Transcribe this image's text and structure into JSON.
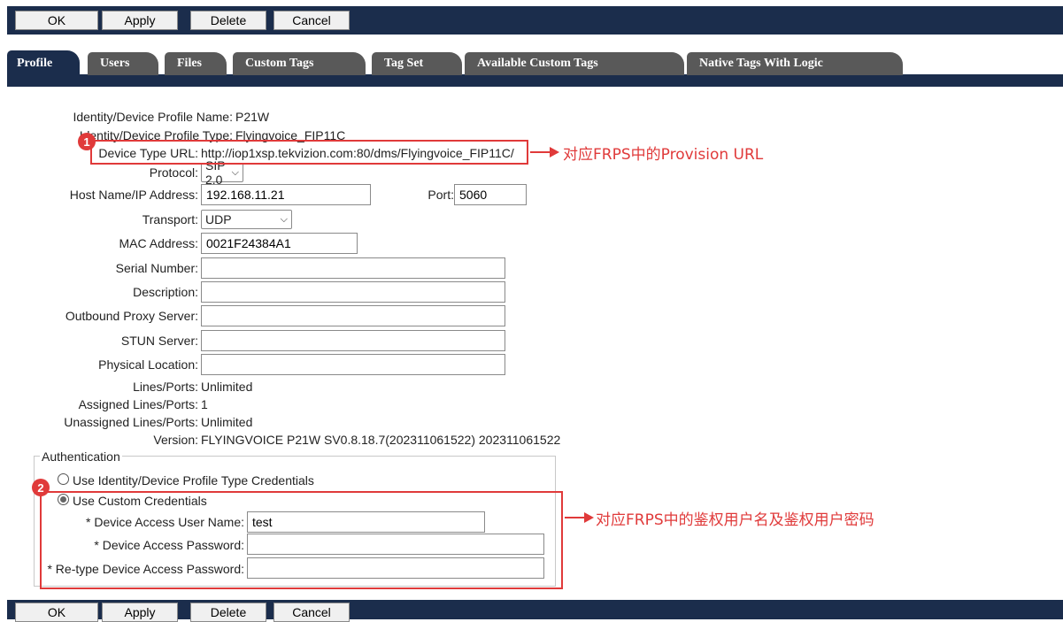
{
  "toolbar": {
    "ok": "OK",
    "apply": "Apply",
    "delete": "Delete",
    "cancel": "Cancel"
  },
  "tabs": [
    "Profile",
    "Users",
    "Files",
    "Custom Tags",
    "Tag Set",
    "Available Custom Tags",
    "Native Tags With Logic"
  ],
  "active_tab": "Profile",
  "profile": {
    "profile_name_label": "Identity/Device Profile Name:",
    "profile_name": "P21W",
    "profile_type_label": "Identity/Device Profile Type:",
    "profile_type": "Flyingvoice_FIP11C",
    "device_type_url_label": "Device Type URL:",
    "device_type_url": "http://iop1xsp.tekvizion.com:80/dms/Flyingvoice_FIP11C/",
    "protocol_label": "Protocol:",
    "protocol": "SIP 2.0",
    "host_label": "Host Name/IP Address:",
    "host": "192.168.11.21",
    "port_label": "Port:",
    "port": "5060",
    "transport_label": "Transport:",
    "transport": "UDP",
    "mac_label": "MAC Address:",
    "mac": "0021F24384A1",
    "serial_label": "Serial Number:",
    "serial": "",
    "description_label": "Description:",
    "description": "",
    "outbound_proxy_label": "Outbound Proxy Server:",
    "outbound_proxy": "",
    "stun_label": "STUN Server:",
    "stun": "",
    "physical_location_label": "Physical Location:",
    "physical_location": "",
    "lines_ports_label": "Lines/Ports:",
    "lines_ports": "Unlimited",
    "assigned_label": "Assigned Lines/Ports:",
    "assigned": "1",
    "unassigned_label": "Unassigned Lines/Ports:",
    "unassigned": "Unlimited",
    "version_label": "Version:",
    "version": "FLYINGVOICE P21W SV0.8.18.7(202311061522) 202311061522"
  },
  "auth": {
    "legend": "Authentication",
    "option_profile_type": "Use Identity/Device Profile Type Credentials",
    "option_custom": "Use Custom Credentials",
    "selected": "custom",
    "username_label": "* Device Access User Name:",
    "username": "test",
    "password_label": "* Device Access Password:",
    "password": "",
    "retype_label": "* Re-type Device Access Password:",
    "retype": ""
  },
  "annotations": {
    "badge1": "1",
    "badge2": "2",
    "note1": "对应FRPS中的Provision URL",
    "note2": "对应FRPS中的鉴权用户名及鉴权用户密码",
    "color": "#e03a3a"
  },
  "colors": {
    "navy": "#1b2d4c",
    "tab_inactive": "#595959"
  }
}
